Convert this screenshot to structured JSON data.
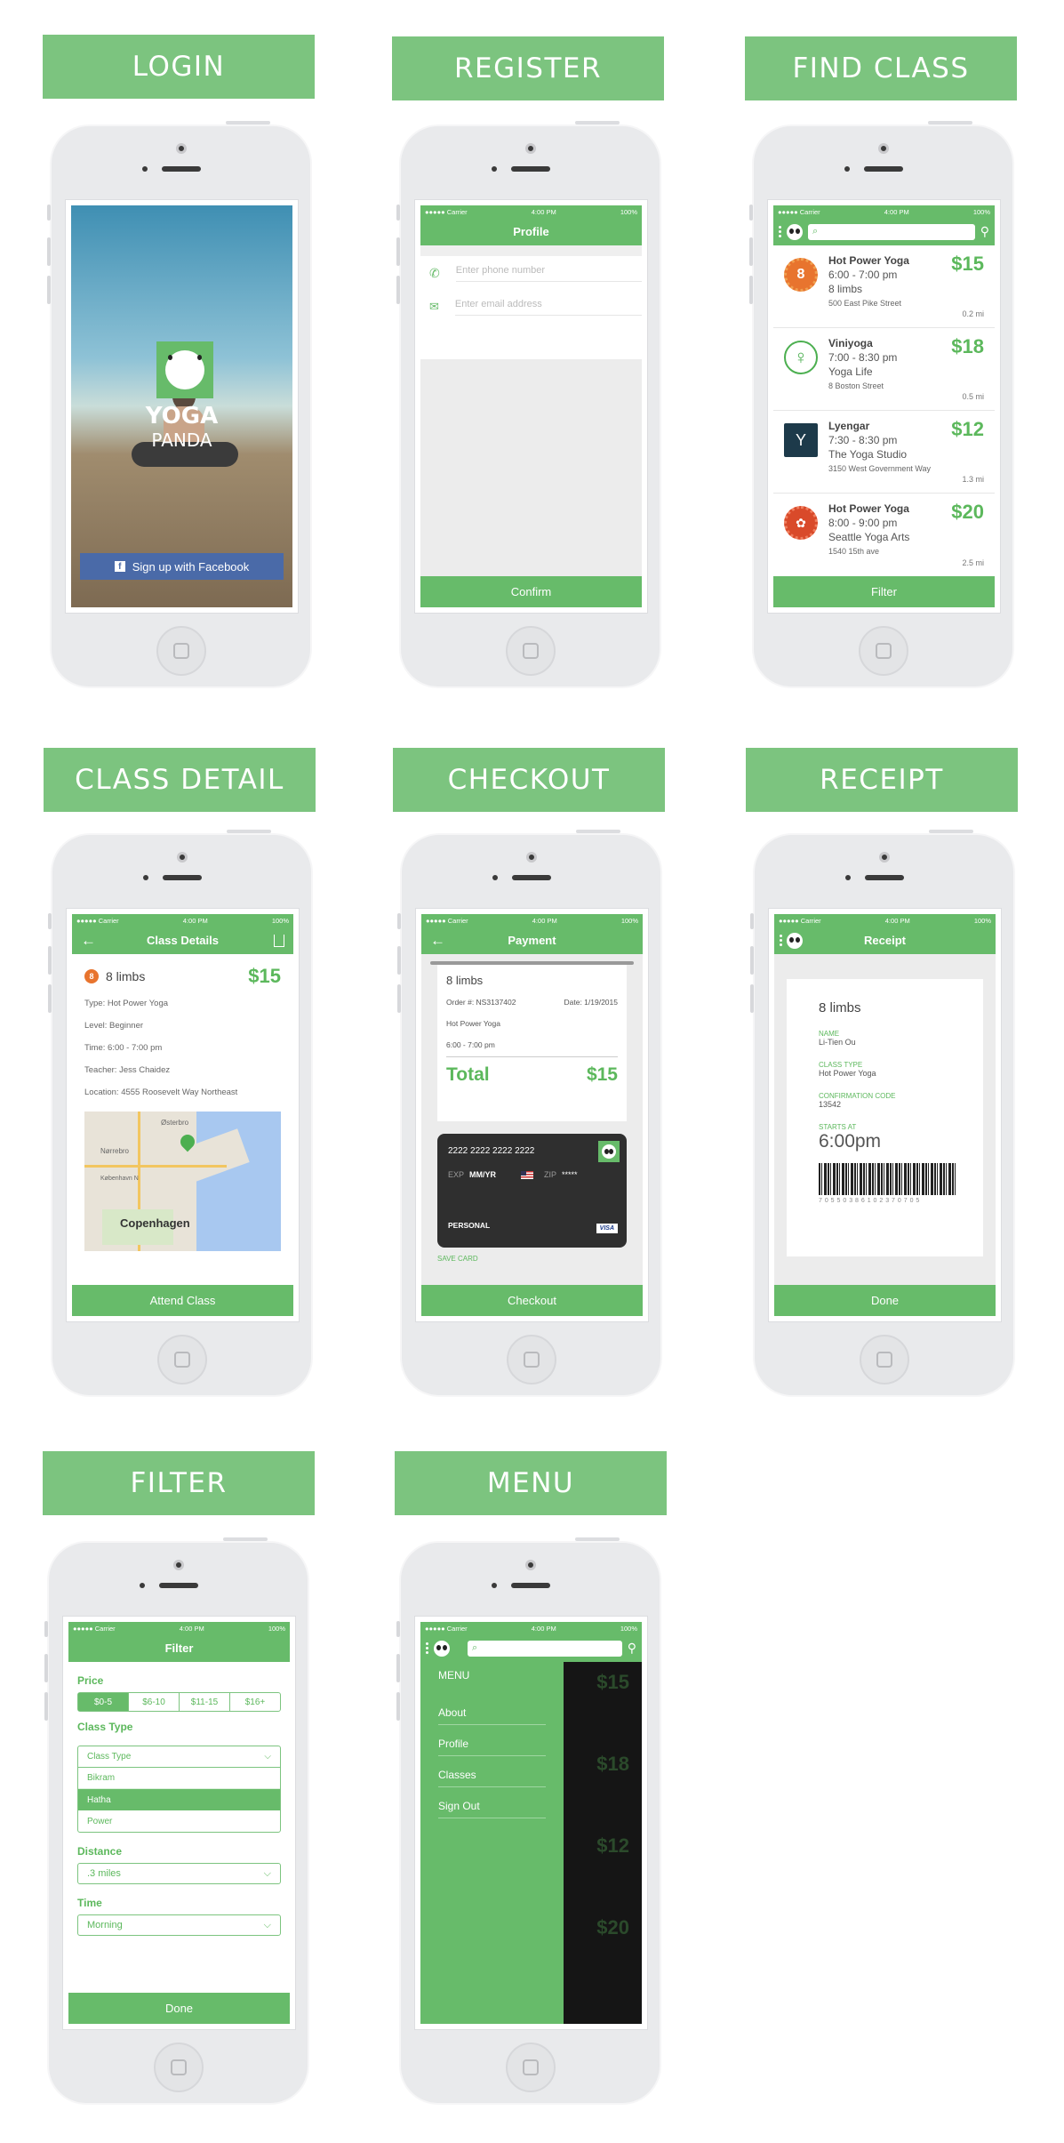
{
  "sections": {
    "login": "LOGIN",
    "register": "REGISTER",
    "find": "FIND CLASS",
    "detail": "CLASS DETAIL",
    "checkout": "CHECKOUT",
    "receipt": "RECEIPT",
    "filter": "FILTER",
    "menu": "MENU"
  },
  "status": {
    "carrier": "●●●●● Carrier",
    "time": "4:00 PM",
    "battery": "100%"
  },
  "login": {
    "logo1": "YOGA",
    "logo2": "PANDA",
    "fb": "Sign up with Facebook"
  },
  "register": {
    "title": "Profile",
    "phone_ph": "Enter phone number",
    "email_ph": "Enter email address",
    "confirm": "Confirm"
  },
  "find": {
    "filter": "Filter",
    "classes": [
      {
        "name": "Hot Power Yoga",
        "time": "6:00 - 7:00 pm",
        "studio": "8 limbs",
        "addr": "500 East Pike Street",
        "price": "$15",
        "dist": "0.2 mi"
      },
      {
        "name": "Viniyoga",
        "time": "7:00 - 8:30 pm",
        "studio": "Yoga Life",
        "addr": "8 Boston Street",
        "price": "$18",
        "dist": "0.5 mi"
      },
      {
        "name": "Lyengar",
        "time": "7:30 - 8:30 pm",
        "studio": "The Yoga Studio",
        "addr": "3150 West Government Way",
        "price": "$12",
        "dist": "1.3 mi"
      },
      {
        "name": "Hot Power Yoga",
        "time": "8:00 - 9:00 pm",
        "studio": "Seattle Yoga Arts",
        "addr": "1540 15th ave",
        "price": "$20",
        "dist": "2.5 mi"
      }
    ]
  },
  "detail": {
    "title": "Class Details",
    "studio": "8 limbs",
    "price": "$15",
    "type": "Type: Hot Power Yoga",
    "level": "Level: Beginner",
    "time": "Time: 6:00 - 7:00 pm",
    "teacher": "Teacher: Jess Chaidez",
    "location": "Location: 4555 Roosevelt Way Northeast",
    "map_city": "Copenhagen",
    "map_a": "Østerbro",
    "map_b": "Nørrebro",
    "map_c": "København N",
    "attend": "Attend Class"
  },
  "checkout": {
    "title": "Payment",
    "studio": "8 limbs",
    "order": "Order #: NS3137402",
    "date": "Date: 1/19/2015",
    "cls": "Hot Power Yoga",
    "time": "6:00 - 7:00 pm",
    "total_l": "Total",
    "total": "$15",
    "card": "2222 2222 2222 2222",
    "exp_l": "EXP",
    "exp": "MM/YR",
    "zip_l": "ZIP",
    "zip": "*****",
    "personal": "PERSONAL",
    "visa": "VISA",
    "save": "SAVE CARD",
    "btn": "Checkout"
  },
  "receipt": {
    "title": "Receipt",
    "studio": "8 limbs",
    "name_l": "NAME",
    "name": "Li-Tien Ou",
    "type_l": "CLASS TYPE",
    "type": "Hot Power Yoga",
    "code_l": "CONFIRMATION CODE",
    "code": "13542",
    "start_l": "STARTS AT",
    "start": "6:00pm",
    "barcode": "7 0 5 5 0 3 8 6 1 0 2 3 7 0 7 0 5",
    "done": "Done"
  },
  "filter": {
    "title": "Filter",
    "price_l": "Price",
    "prices": [
      "$0-5",
      "$6-10",
      "$11-15",
      "$16+"
    ],
    "type_l": "Class Type",
    "type_ph": "Class Type",
    "types": [
      "Bikram",
      "Hatha",
      "Power"
    ],
    "dist_l": "Distance",
    "dist": ".3 miles",
    "time_l": "Time",
    "time": "Morning",
    "done": "Done"
  },
  "menu": {
    "title": "MENU",
    "items": [
      "About",
      "Profile",
      "Classes",
      "Sign Out"
    ],
    "bg_prices": [
      "$15",
      "$18",
      "$12",
      "$20"
    ]
  }
}
